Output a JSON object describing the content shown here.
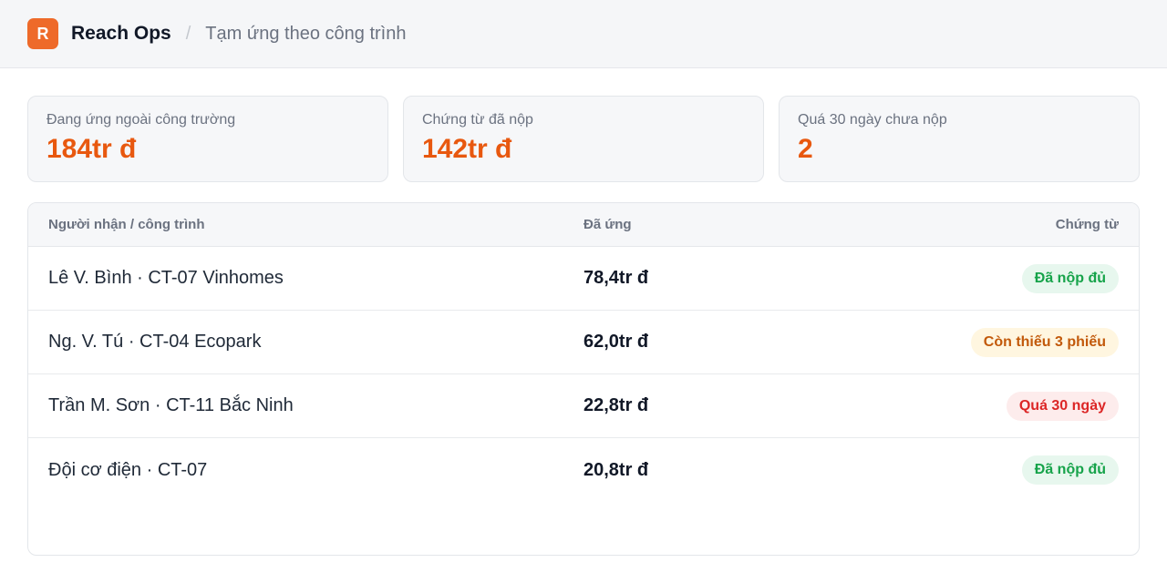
{
  "header": {
    "logo_letter": "R",
    "app_name": "Reach Ops",
    "separator": "/",
    "breadcrumb": "Tạm ứng theo công trình"
  },
  "stats": [
    {
      "label": "Đang ứng ngoài công trường",
      "value": "184tr đ"
    },
    {
      "label": "Chứng từ đã nộp",
      "value": "142tr đ"
    },
    {
      "label": "Quá 30 ngày chưa nộp",
      "value": "2"
    }
  ],
  "table": {
    "columns": [
      "Người nhận / công trình",
      "Đã ứng",
      "Chứng từ"
    ],
    "rows": [
      {
        "name": "Lê V. Bình · CT-07 Vinhomes",
        "amount": "78,4tr đ",
        "status": "Đã nộp đủ",
        "status_type": "ok"
      },
      {
        "name": "Ng. V. Tú · CT-04 Ecopark",
        "amount": "62,0tr đ",
        "status": "Còn thiếu 3 phiếu",
        "status_type": "warn"
      },
      {
        "name": "Trần M. Sơn · CT-11 Bắc Ninh",
        "amount": "22,8tr đ",
        "status": "Quá 30 ngày",
        "status_type": "late"
      },
      {
        "name": "Đội cơ điện · CT-07",
        "amount": "20,8tr đ",
        "status": "Đã nộp đủ",
        "status_type": "ok"
      }
    ]
  },
  "colors": {
    "accent": "#e8580f",
    "logo_bg": "#ee6a2a",
    "status_ok": "#16a34a",
    "status_warn": "#c2590a",
    "status_late": "#dc2626"
  }
}
